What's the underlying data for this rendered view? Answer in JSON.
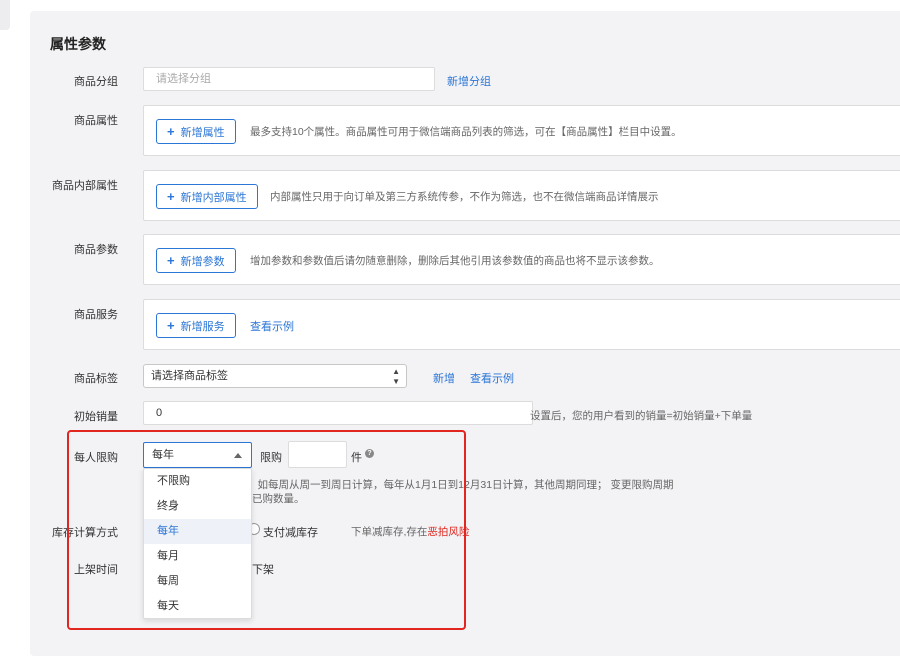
{
  "section_title": "属性参数",
  "group": {
    "label": "商品分组",
    "placeholder": "请选择分组",
    "add_link": "新增分组"
  },
  "attributes": {
    "label": "商品属性",
    "button": "新增属性",
    "hint": "最多支持10个属性。商品属性可用于微信端商品列表的筛选，可在【商品属性】栏目中设置。"
  },
  "internal_attributes": {
    "label": "商品内部属性",
    "button": "新增内部属性",
    "hint": "内部属性只用于向订单及第三方系统传参，不作为筛选，也不在微信端商品详情展示"
  },
  "params": {
    "label": "商品参数",
    "button": "新增参数",
    "hint": "增加参数和参数值后请勿随意删除，删除后其他引用该参数值的商品也将不显示该参数。"
  },
  "services": {
    "label": "商品服务",
    "button": "新增服务",
    "example_link": "查看示例"
  },
  "tags": {
    "label": "商品标签",
    "select_value": "请选择商品标签",
    "add_link": "新增",
    "example_link": "查看示例"
  },
  "initial_sales": {
    "label": "初始销量",
    "value": "0",
    "hint": "设置后，您的用户看到的销量=初始销量+下单量"
  },
  "purchase_limit": {
    "label": "每人限购",
    "selected": "每年",
    "limit_label": "限购",
    "unit": "件",
    "help_icon": "question-circle-icon",
    "hint_line1": "，如每周从周一到周日计算，每年从1月1日到12月31日计算，其他周期同理； 变更限购周期",
    "hint_line2": "已购数量。",
    "options": [
      "不限购",
      "终身",
      "每年",
      "每月",
      "每周",
      "每天"
    ],
    "selected_index": 2
  },
  "stock_calc": {
    "label": "库存计算方式",
    "option": "支付减库存",
    "hint_prefix": "下单减库存,存在",
    "hint_warn": "恶拍风险"
  },
  "shelf_time": {
    "label": "上架时间",
    "partial_text": "下架"
  },
  "colors": {
    "accent": "#2b76d6",
    "warning": "#e0261e",
    "panel_bg": "#f3f3f6"
  }
}
